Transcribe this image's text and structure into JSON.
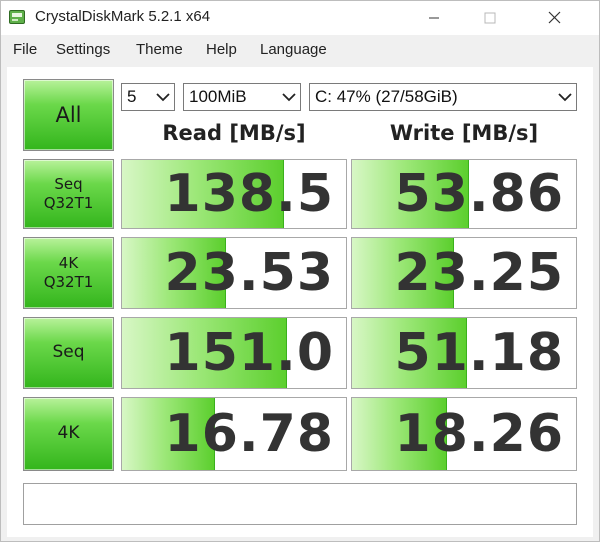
{
  "window": {
    "title": "CrystalDiskMark 5.2.1 x64"
  },
  "menu": [
    "File",
    "Settings",
    "Theme",
    "Help",
    "Language"
  ],
  "controls": {
    "all_label": "All",
    "count": "5",
    "size": "100MiB",
    "drive": "C: 47% (27/58GiB)"
  },
  "headers": {
    "read": "Read [MB/s]",
    "write": "Write [MB/s]"
  },
  "tests": [
    {
      "label": "Seq\nQ32T1",
      "read": "138.5",
      "write": "53.86",
      "read_level": 0.72,
      "write_level": 0.52
    },
    {
      "label": "4K\nQ32T1",
      "read": "23.53",
      "write": "23.25",
      "read_level": 0.46,
      "write_level": 0.45
    },
    {
      "label": "Seq",
      "read": "151.0",
      "write": "51.18",
      "read_level": 0.73,
      "write_level": 0.51
    },
    {
      "label": "4K",
      "read": "16.78",
      "write": "18.26",
      "read_level": 0.41,
      "write_level": 0.42
    }
  ],
  "status_text": "",
  "colors": {
    "accent_green": "#33b51c",
    "text_dark": "#333333"
  }
}
